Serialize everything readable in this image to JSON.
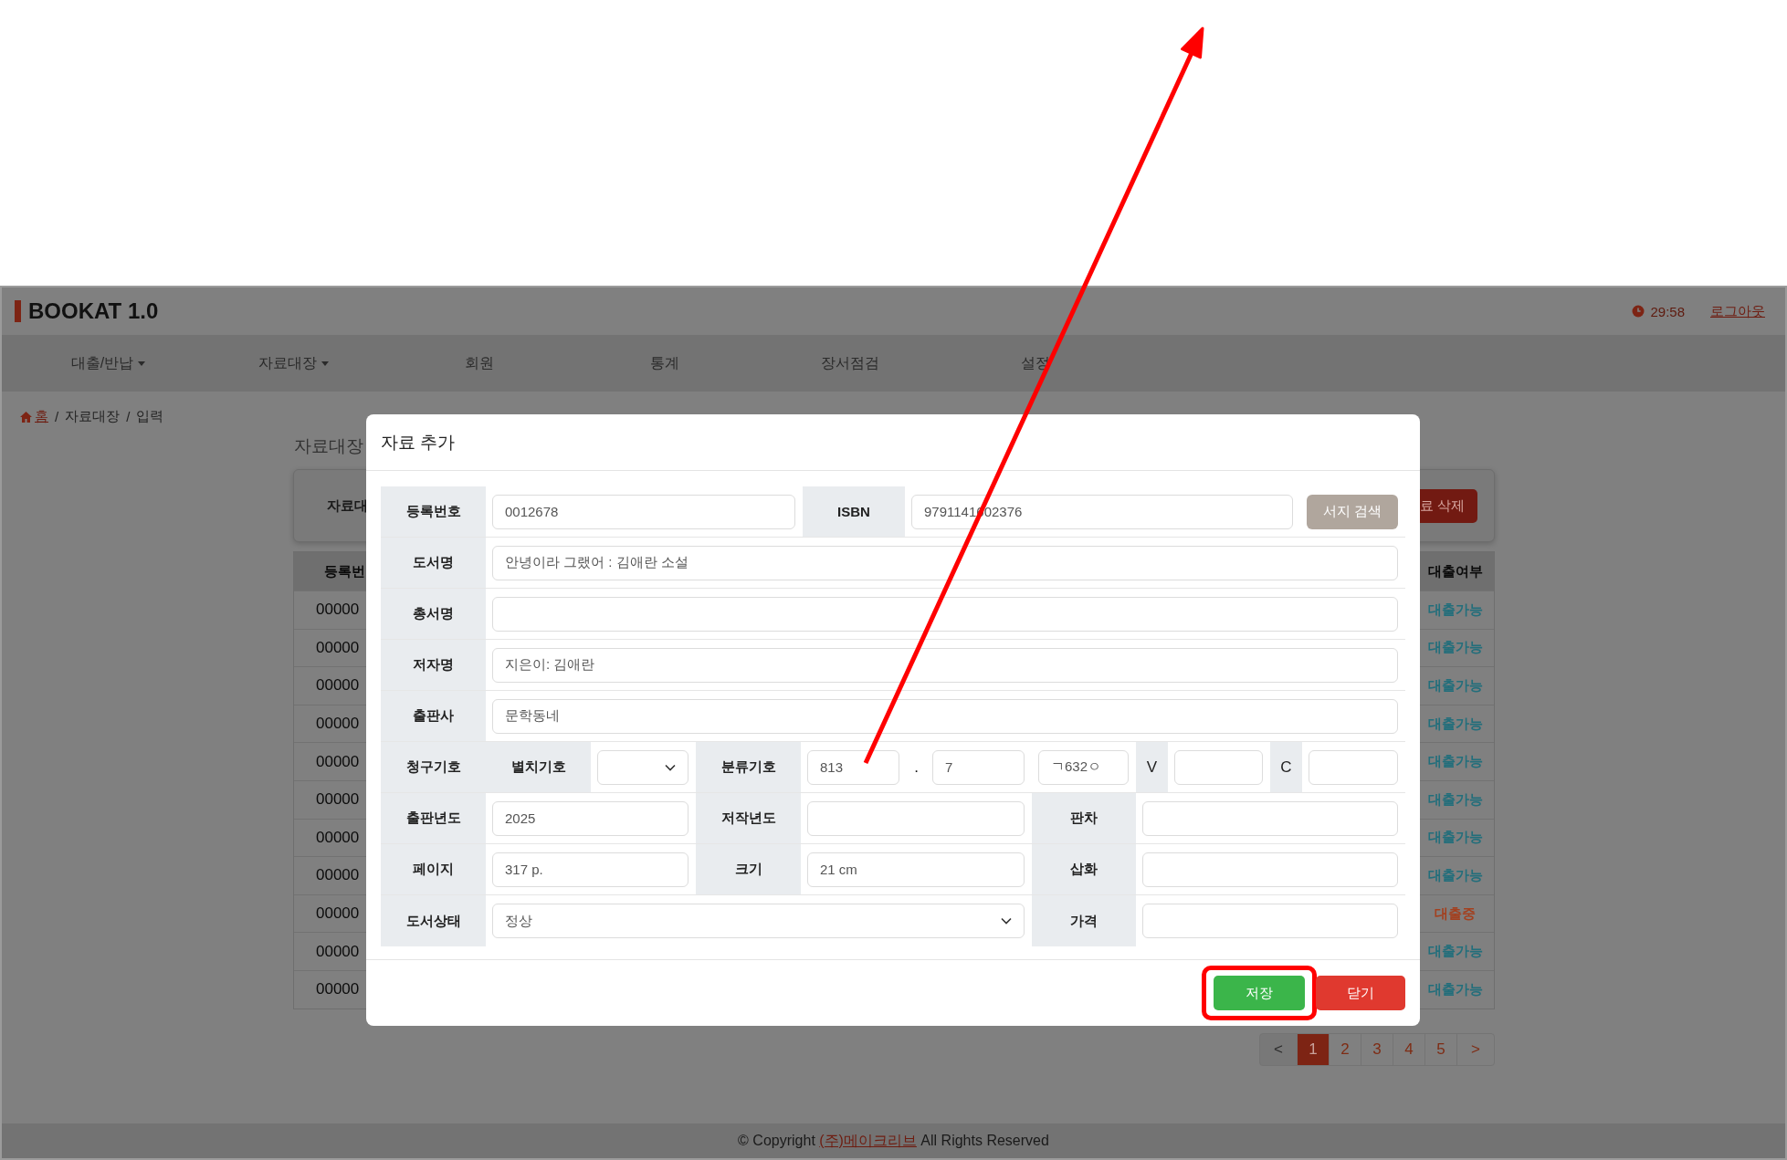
{
  "header": {
    "logo": "BOOKAT 1.0",
    "timer": "29:58",
    "logout": "로그아웃"
  },
  "nav": [
    {
      "label": "대출/반납",
      "dropdown": true
    },
    {
      "label": "자료대장",
      "dropdown": true
    },
    {
      "label": "회원",
      "dropdown": false
    },
    {
      "label": "통계",
      "dropdown": false
    },
    {
      "label": "장서점검",
      "dropdown": false
    },
    {
      "label": "설정",
      "dropdown": false
    }
  ],
  "breadcrumb": [
    {
      "kind": "home",
      "label": "홈"
    },
    {
      "kind": "sep",
      "label": "/"
    },
    {
      "kind": "text",
      "label": "자료대장"
    },
    {
      "kind": "sep",
      "label": "/"
    },
    {
      "kind": "text",
      "label": "입력"
    }
  ],
  "page_title": "자료대장",
  "search_card": {
    "label": "자료대",
    "delete_button": "료 삭제"
  },
  "table": {
    "columns": [
      "등록번",
      "대출여부"
    ],
    "rows": [
      {
        "cells": [
          "00000",
          "대출가능"
        ],
        "color": "#226e7b"
      },
      {
        "cells": [
          "00000",
          "대출가능"
        ],
        "color": "#226e7b"
      },
      {
        "cells": [
          "00000",
          "대출가능"
        ],
        "color": "#226e7b"
      },
      {
        "cells": [
          "00000",
          "대출가능"
        ],
        "color": "#226e7b"
      },
      {
        "cells": [
          "00000",
          "대출가능"
        ],
        "color": "#226e7b"
      },
      {
        "cells": [
          "00000",
          "대출가능"
        ],
        "color": "#226e7b"
      },
      {
        "cells": [
          "00000",
          "대출가능"
        ],
        "color": "#226e7b"
      },
      {
        "cells": [
          "00000",
          "대출가능"
        ],
        "color": "#226e7b"
      },
      {
        "cells": [
          "00000",
          "대출중"
        ],
        "color": "#a3401f"
      },
      {
        "cells": [
          "00000",
          "대출가능"
        ],
        "color": "#226e7b"
      },
      {
        "cells": [
          "00000",
          "대출가능"
        ],
        "color": "#226e7b"
      }
    ]
  },
  "pagination": [
    {
      "label": "<",
      "selected": false
    },
    {
      "label": "1",
      "selected": true
    },
    {
      "label": "2",
      "selected": false
    },
    {
      "label": "3",
      "selected": false
    },
    {
      "label": "4",
      "selected": false
    },
    {
      "label": "5",
      "selected": false
    },
    {
      "label": ">",
      "selected": false
    }
  ],
  "footer": {
    "prefix": "© Copyright",
    "link": "(주)메이크리브",
    "suffix": "All Rights Reserved"
  },
  "modal": {
    "title": "자료 추가",
    "form_lines": [
      {
        "kind": "isbn",
        "fields": [
          {
            "kind": "input",
            "label": "등록번호",
            "value": "0012678"
          },
          {
            "kind": "input",
            "label": "ISBN",
            "value": "9791141602376"
          },
          {
            "kind": "button",
            "text": "서지 검색"
          }
        ]
      },
      {
        "kind": "wide",
        "fields": [
          {
            "kind": "input",
            "label": "도서명",
            "value": "안녕이라 그랬어 : 김애란 소설"
          }
        ]
      },
      {
        "kind": "wide",
        "fields": [
          {
            "kind": "input",
            "label": "총서명"
          }
        ]
      },
      {
        "kind": "wide",
        "fields": [
          {
            "kind": "input",
            "label": "저자명",
            "value": "지은이: 김애란"
          }
        ]
      },
      {
        "kind": "wide",
        "fields": [
          {
            "kind": "input",
            "label": "출판사",
            "value": "문학동네"
          }
        ]
      },
      {
        "kind": "call",
        "fields": [
          {
            "kind": "heading",
            "label": "청구기호"
          },
          {
            "kind": "select",
            "label": "별치기호"
          },
          {
            "kind": "input",
            "label": "분류기호",
            "value": "813"
          },
          {
            "kind": "dot",
            "text": "."
          },
          {
            "kind": "input",
            "value": "7"
          },
          {
            "kind": "input",
            "value": "ㄱ632ㅇ"
          },
          {
            "kind": "input",
            "label": "V",
            "letter": true
          },
          {
            "kind": "input",
            "label": "C",
            "letter": true
          }
        ]
      },
      {
        "kind": "triple",
        "fields": [
          {
            "kind": "input",
            "label": "출판년도",
            "value": "2025"
          },
          {
            "kind": "input",
            "label": "저작년도"
          },
          {
            "kind": "input",
            "label": "판차"
          }
        ]
      },
      {
        "kind": "triple",
        "fields": [
          {
            "kind": "input",
            "label": "페이지",
            "value": "317 p."
          },
          {
            "kind": "input",
            "label": "크기",
            "value": "21 cm"
          },
          {
            "kind": "input",
            "label": "삽화"
          }
        ]
      },
      {
        "kind": "status",
        "fields": [
          {
            "kind": "select",
            "label": "도서상태",
            "value": "정상"
          },
          {
            "kind": "input",
            "label": "가격"
          }
        ]
      }
    ],
    "buttons": [
      {
        "kind": "save",
        "label": "저장",
        "highlighted": true
      },
      {
        "kind": "close",
        "label": "닫기",
        "highlighted": false
      }
    ]
  }
}
